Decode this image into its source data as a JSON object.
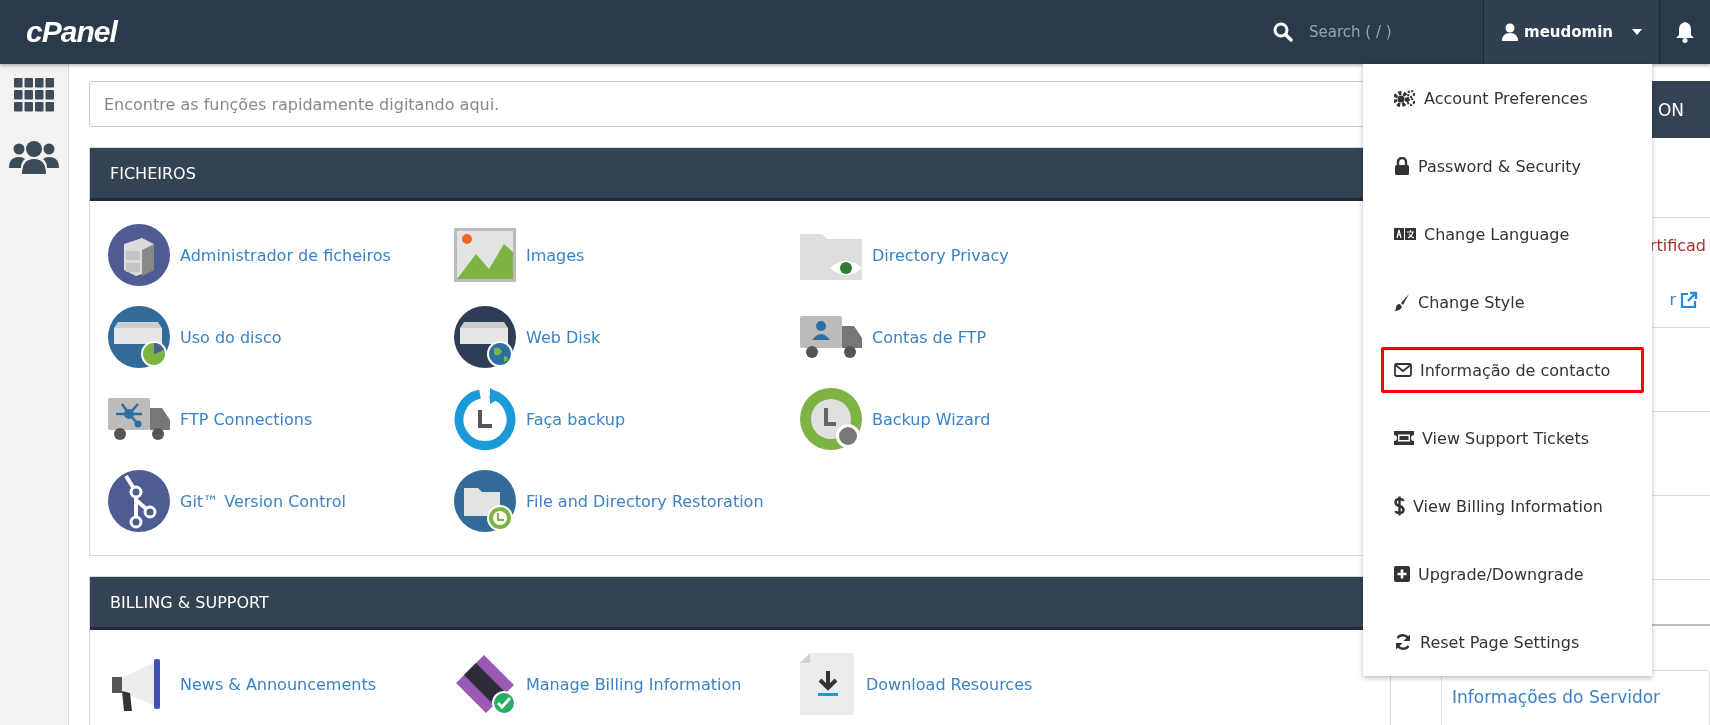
{
  "topbar": {
    "logo": "cPanel",
    "search": {
      "placeholder": "Search ( / )"
    },
    "user": {
      "name": "meudomin",
      "expanded": true
    }
  },
  "quick_search": {
    "placeholder": "Encontre as funções rapidamente digitando aqui."
  },
  "sections": [
    {
      "title": "FICHEIROS",
      "items": [
        {
          "label": "Administrador de ficheiros"
        },
        {
          "label": "Images"
        },
        {
          "label": "Directory Privacy"
        },
        {
          "label": "Uso do disco"
        },
        {
          "label": "Web Disk"
        },
        {
          "label": "Contas de FTP"
        },
        {
          "label": "FTP Connections"
        },
        {
          "label": "Faça backup"
        },
        {
          "label": "Backup Wizard"
        },
        {
          "label": "Git™ Version Control"
        },
        {
          "label": "File and Directory Restoration"
        }
      ]
    },
    {
      "title": "BILLING & SUPPORT",
      "items": [
        {
          "label": "News & Announcements"
        },
        {
          "label": "Manage Billing Information"
        },
        {
          "label": "Download Resources"
        }
      ]
    }
  ],
  "right_panel": {
    "header": "ON",
    "lines": [
      {
        "kind": "warning",
        "text": "rtificad"
      },
      {
        "kind": "link",
        "text": "r"
      }
    ],
    "server_info": "Informações do Servidor"
  },
  "user_menu": {
    "items": [
      {
        "label": "Account Preferences",
        "highlighted": false
      },
      {
        "label": "Password & Security",
        "highlighted": false
      },
      {
        "label": "Change Language",
        "highlighted": false
      },
      {
        "label": "Change Style",
        "highlighted": false
      },
      {
        "label": "Informação de contacto",
        "highlighted": true
      },
      {
        "label": "View Support Tickets",
        "highlighted": false
      },
      {
        "label": "View Billing Information",
        "highlighted": false
      },
      {
        "label": "Upgrade/Downgrade",
        "highlighted": false
      },
      {
        "label": "Reset Page Settings",
        "highlighted": false
      }
    ]
  }
}
